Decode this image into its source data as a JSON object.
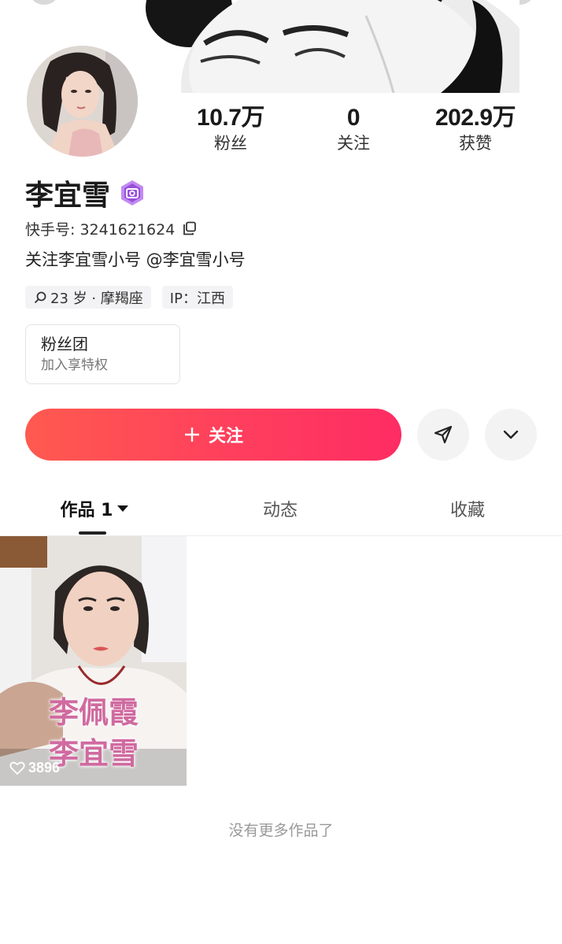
{
  "profile": {
    "name": "李宜雪",
    "uid_label": "快手号: 3241621624",
    "bio": "关注李宜雪小号 @李宜雪小号",
    "tags": [
      {
        "icon": "search-icon",
        "text": "23 岁 · 摩羯座"
      },
      {
        "icon": "",
        "text": "IP：江西"
      }
    ]
  },
  "stats": [
    {
      "value": "10.7万",
      "label": "粉丝"
    },
    {
      "value": "0",
      "label": "关注"
    },
    {
      "value": "202.9万",
      "label": "获赞"
    }
  ],
  "fan_club": {
    "title": "粉丝团",
    "subtitle": "加入享特权"
  },
  "actions": {
    "follow_label": "关注",
    "follow_icon": "plus-icon",
    "share_icon": "send-icon",
    "more_icon": "chevron-down-icon"
  },
  "tabs": [
    {
      "label": "作品 1",
      "active": true
    },
    {
      "label": "动态",
      "active": false
    },
    {
      "label": "收藏",
      "active": false
    }
  ],
  "videos": [
    {
      "caption_line1": "李佩霞",
      "caption_line2": "李宜雪",
      "likes": "3896"
    }
  ],
  "footer": {
    "no_more": "没有更多作品了"
  },
  "colors": {
    "accent": "#fe2c55",
    "accent_start": "#ff5a4f",
    "badge": "#b36be6"
  }
}
